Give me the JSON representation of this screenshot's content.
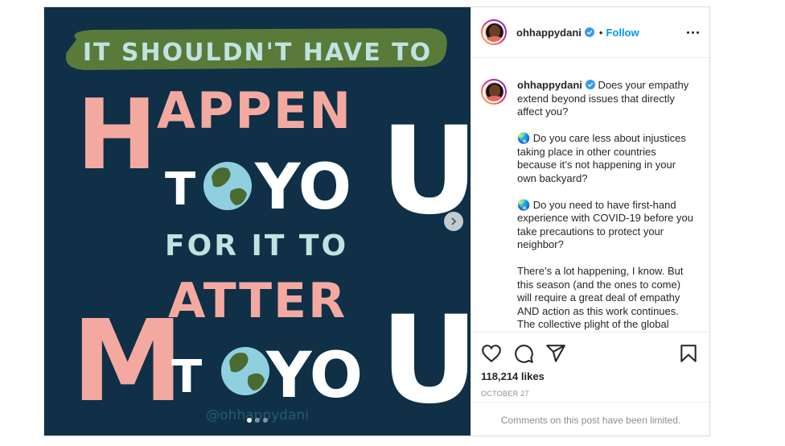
{
  "post": {
    "username": "ohhappydani",
    "follow_separator": "•",
    "follow_label": "Follow",
    "caption": {
      "username": "ohhappydani",
      "paragraph_1": " Does your empathy extend beyond issues that directly affect you?",
      "paragraph_2": "🌏 Do you care less about injustices taking place in other countries because it’s not happening in your own backyard?",
      "paragraph_3": "🌏 Do you need to have first-hand experience with COVID-19 before you take precautions to protect your neighbor?",
      "paragraph_4": "There’s a lot happening, I know. But this season (and the ones to come) will require a great deal of empathy AND action as this work continues. The collective plight of the global"
    },
    "likes": "118,214 likes",
    "date": "OCTOBER 27",
    "comments_limited": "Comments on this post have been limited."
  },
  "artwork": {
    "line_1": "IT SHOULDN'T HAVE TO",
    "line_2": "HAPPEN",
    "line_3a": "T",
    "line_3b": "YOU",
    "line_4": "FOR IT TO",
    "line_5": "MATTER",
    "line_6a": "T",
    "line_6b": "YOU",
    "big_u_1": "U",
    "big_u_2": "U",
    "watermark": "@ohhappydani",
    "colors": {
      "background": "#0f3046",
      "pink": "#f4a9a0",
      "banner": "#5a7a3a",
      "light_blue": "#bfe3e0",
      "white": "#ffffff"
    }
  },
  "carousel": {
    "slide_count": 3,
    "active_slide": 1
  },
  "icons": {
    "next": "chevron-right-icon",
    "more": "more-options-icon",
    "like": "heart-icon",
    "comment": "comment-icon",
    "share": "share-icon",
    "save": "bookmark-icon",
    "verified": "verified-badge-icon"
  }
}
